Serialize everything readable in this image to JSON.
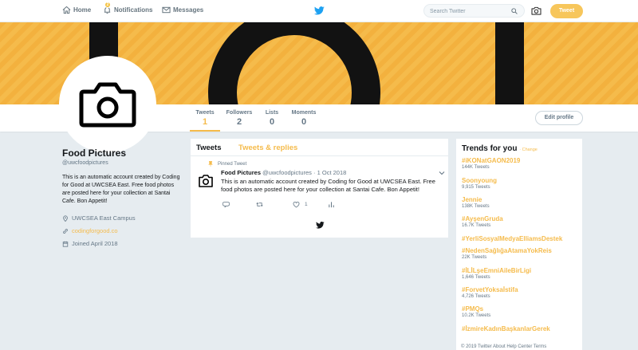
{
  "topnav": {
    "home_label": "Home",
    "notifications_label": "Notifications",
    "notifications_badge": "2",
    "messages_label": "Messages",
    "search_placeholder": "Search Twitter",
    "tweet_button": "Tweet"
  },
  "colors": {
    "accent": "#f5bb4b",
    "banner_bg": "#f5bb4b",
    "banner_dark": "#121212"
  },
  "profile_nav": {
    "stats": [
      {
        "label": "Tweets",
        "value": "1"
      },
      {
        "label": "Followers",
        "value": "2"
      },
      {
        "label": "Lists",
        "value": "0"
      },
      {
        "label": "Moments",
        "value": "0"
      }
    ],
    "edit_button": "Edit profile"
  },
  "profile": {
    "name": "Food Pictures",
    "handle": "@uwcfoodpictures",
    "bio": "This is an automatic account created by Coding for Good at UWCSEA East. Free food photos are posted here for your collection at Santai Cafe. Bon Appetit!",
    "location": "UWCSEA East Campus",
    "link": "codingforgood.co",
    "joined": "Joined April 2018"
  },
  "timeline": {
    "tab_tweets": "Tweets",
    "tab_replies": "Tweets & replies",
    "pinned_label": "Pinned Tweet",
    "tweet": {
      "name": "Food Pictures",
      "handle": "@uwcfoodpictures",
      "separator": "·",
      "date": "1 Oct 2018",
      "text": "This is an automatic account created by Coding for Good at UWCSEA East. Free food photos are posted here for your collection at Santai Cafe. Bon Appetit!",
      "like_count": "1"
    }
  },
  "trends": {
    "title": "Trends for you",
    "change": "· Change",
    "items": [
      {
        "name": "#iKONatGAON2019",
        "count": "144K Tweets"
      },
      {
        "name": "Soonyoung",
        "count": "9,915 Tweets"
      },
      {
        "name": "Jennie",
        "count": "138K Tweets"
      },
      {
        "name": "#AyşenGruda",
        "count": "16.7K Tweets"
      },
      {
        "name": "#YerliSosyalMedyaElliamsDestek",
        "count": ""
      },
      {
        "name": "#NedenSağlığaAtamaYokReis",
        "count": "22K Tweets"
      },
      {
        "name": "#İLİLşeEmniAileBirLigi",
        "count": "1,646 Tweets"
      },
      {
        "name": "#ForvetYoksaİstifa",
        "count": "4,726 Tweets"
      },
      {
        "name": "#PMQs",
        "count": "10.2K Tweets"
      },
      {
        "name": "#İzmireKadınBaşkanlarGerek",
        "count": ""
      }
    ]
  },
  "footer": "© 2019 Twitter   About   Help Center   Terms"
}
